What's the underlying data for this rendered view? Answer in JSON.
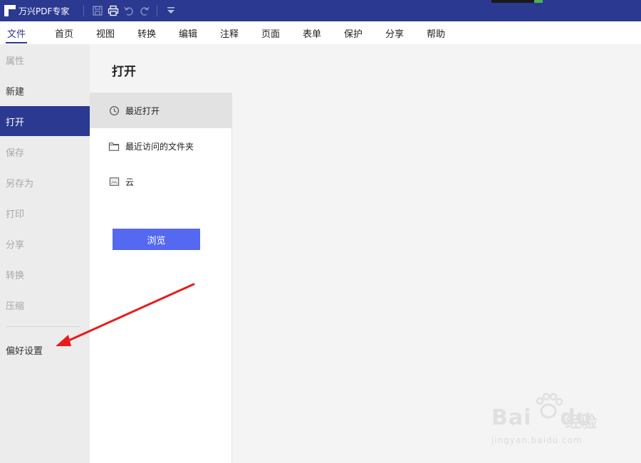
{
  "app": {
    "title": "万兴PDF专家"
  },
  "colors": {
    "titlebar": "#2b3990",
    "accent": "#2b3990",
    "browse_button": "#5468f0",
    "arrow": "#e81c1c"
  },
  "titlebar_icons": [
    "save-icon",
    "print-icon",
    "undo-icon",
    "redo-icon",
    "dropdown-icon"
  ],
  "menu": {
    "items": [
      "文件",
      "首页",
      "视图",
      "转换",
      "编辑",
      "注释",
      "页面",
      "表单",
      "保护",
      "分享",
      "帮助"
    ],
    "active": "文件"
  },
  "sidebar": {
    "items": [
      "属性",
      "新建",
      "打开",
      "保存",
      "另存为",
      "打印",
      "分享",
      "转换",
      "压缩",
      "偏好设置"
    ],
    "active": "打开"
  },
  "open_panel": {
    "title": "打开",
    "items": [
      {
        "label": "最近打开",
        "icon": "clock-icon"
      },
      {
        "label": "最近访问的文件夹",
        "icon": "folder-icon"
      },
      {
        "label": "云",
        "icon": "cloud-image-icon"
      }
    ],
    "browse_label": "浏览"
  },
  "watermark": {
    "main": "Bai",
    "main2": "du",
    "cn": "经验",
    "sub": "jingyan.baidu.com"
  }
}
